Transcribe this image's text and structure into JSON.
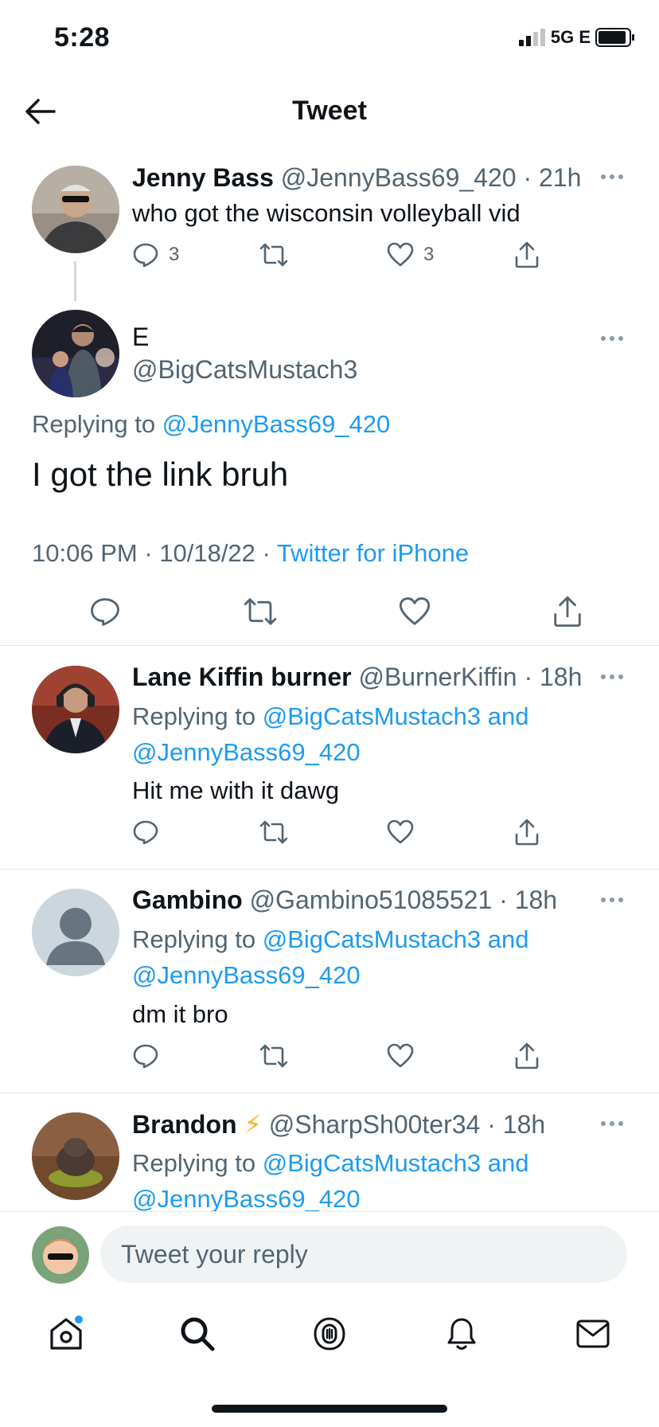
{
  "status_bar": {
    "time": "5:28",
    "network": "5G E"
  },
  "header": {
    "title": "Tweet"
  },
  "parent_tweet": {
    "name": "Jenny Bass",
    "handle": "@JennyBass69_420",
    "time": "· 21h",
    "text": "who got the wisconsin volleyball vid",
    "replies": "3",
    "likes": "3"
  },
  "main_tweet": {
    "name": "E",
    "handle": "@BigCatsMustach3",
    "replying_prefix": "Replying to",
    "replying_to": "@JennyBass69_420",
    "text": "I got the link bruh",
    "timestamp": "10:06 PM · 10/18/22 ·",
    "source": "Twitter for iPhone"
  },
  "replies": [
    {
      "name": "Lane Kiffin burner",
      "handle": "@BurnerKiffin",
      "time": "· 18h",
      "replying_prefix": "Replying to",
      "replying_to_line1": "@BigCatsMustach3 and",
      "replying_to_line2": "@JennyBass69_420",
      "text": "Hit me with it dawg"
    },
    {
      "name": "Gambino",
      "handle": "@Gambino51085521",
      "time": "· 18h",
      "replying_prefix": "Replying to",
      "replying_to_line1": "@BigCatsMustach3 and",
      "replying_to_line2": "@JennyBass69_420",
      "text": "dm it bro"
    },
    {
      "name": "Brandon",
      "name_emoji": "⚡",
      "handle": "@SharpSh00ter34",
      "time": "· 18h",
      "replying_prefix": "Replying to",
      "replying_to_line1": "@BigCatsMustach3 and",
      "replying_to_line2": "@JennyBass69_420"
    }
  ],
  "reply_box": {
    "placeholder": "Tweet your reply"
  },
  "tabs": [
    "home-icon",
    "search-icon",
    "spaces-icon",
    "notifications-icon",
    "messages-icon"
  ],
  "colors": {
    "accent": "#1d9bf0",
    "text": "#0f1419",
    "secondary": "#536471"
  }
}
